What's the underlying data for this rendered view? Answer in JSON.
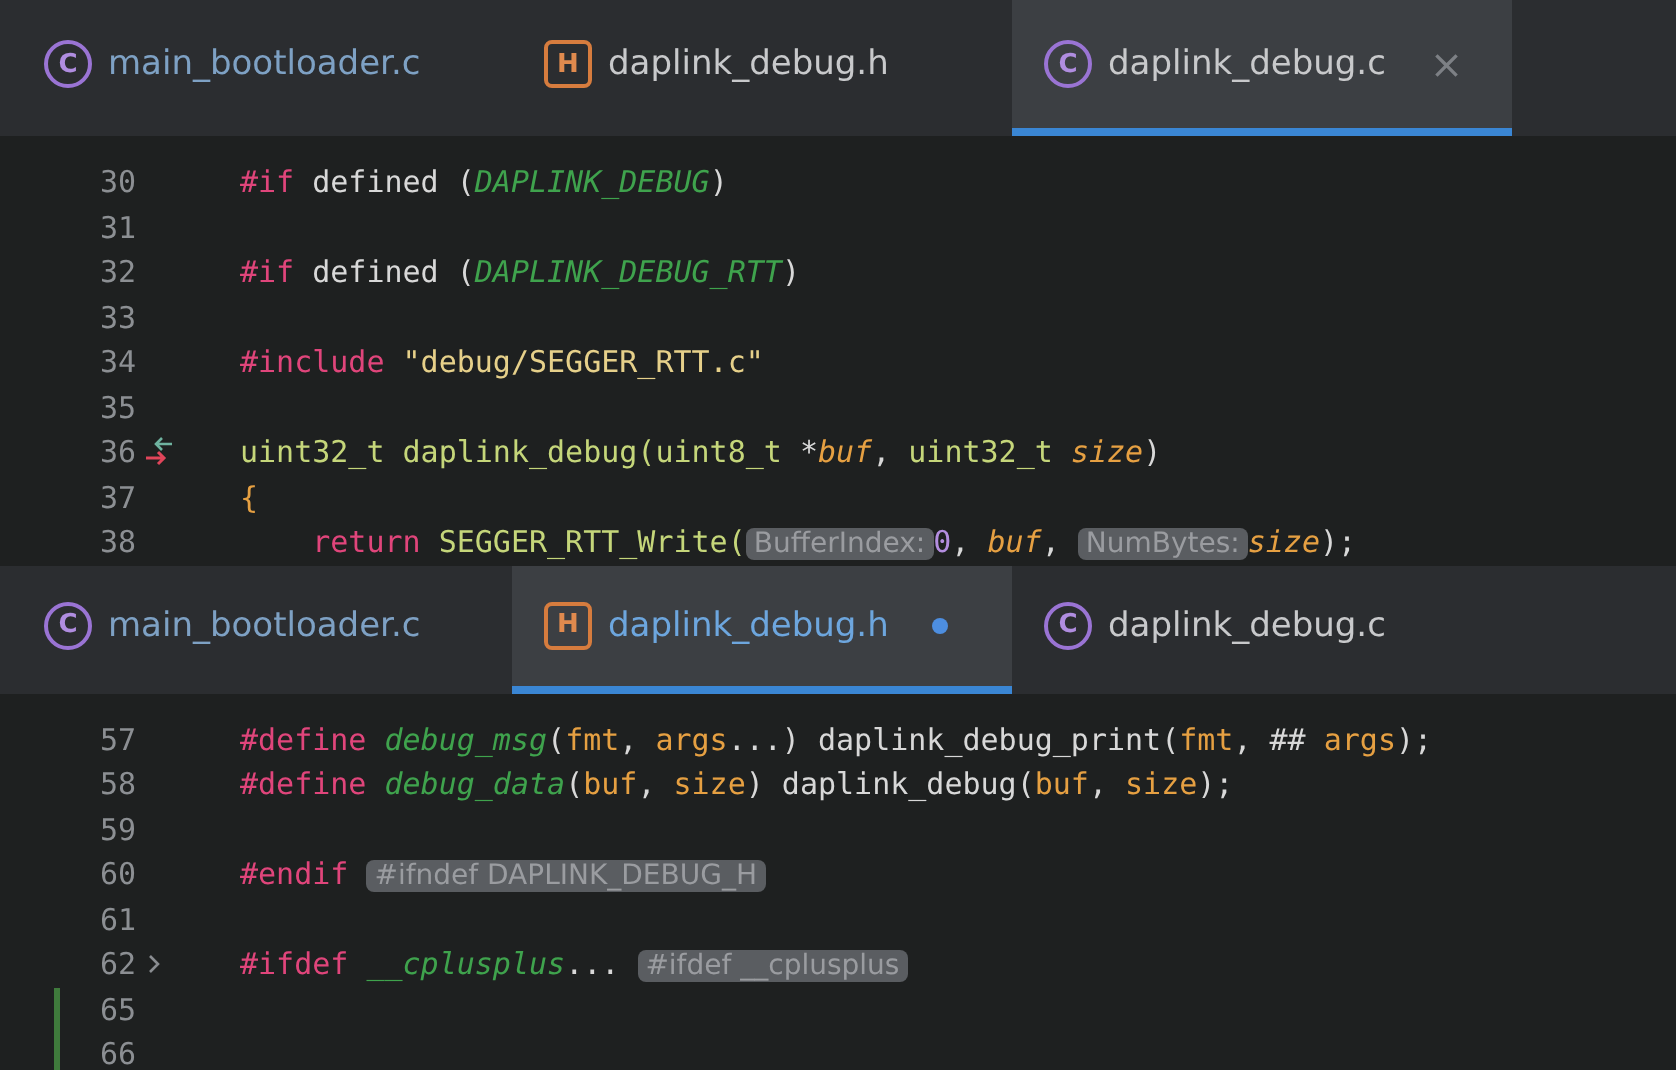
{
  "panes": [
    {
      "tabs": [
        {
          "icon": "C",
          "kind": "c",
          "label": "main_bootloader.c",
          "selected": false,
          "modified": false
        },
        {
          "icon": "H",
          "kind": "h",
          "label": "daplink_debug.h",
          "selected": false,
          "modified": false
        },
        {
          "icon": "C",
          "kind": "c",
          "label": "daplink_debug.c",
          "selected": true,
          "modified": false,
          "close": "×"
        }
      ],
      "lines": [
        {
          "number": "30",
          "kind": "code",
          "tokens": [
            {
              "kind": "keyword",
              "text": "#if"
            },
            {
              "kind": "plain",
              "text": " defined ("
            },
            {
              "kind": "macro",
              "text": "DAPLINK_DEBUG"
            },
            {
              "kind": "plain",
              "text": ")"
            }
          ]
        },
        {
          "number": "31",
          "kind": "code"
        },
        {
          "number": "32",
          "kind": "code",
          "tokens": [
            {
              "kind": "keyword",
              "text": "#if"
            },
            {
              "kind": "plain",
              "text": " defined ("
            },
            {
              "kind": "macro",
              "text": "DAPLINK_DEBUG_RTT"
            },
            {
              "kind": "plain",
              "text": ")"
            }
          ]
        },
        {
          "number": "33",
          "kind": "code"
        },
        {
          "number": "34",
          "kind": "code",
          "tokens": [
            {
              "kind": "keyword",
              "text": "#include "
            },
            {
              "kind": "string",
              "text": "\"debug/SEGGER_RTT.c\""
            }
          ]
        },
        {
          "number": "35",
          "kind": "code"
        },
        {
          "number": "36",
          "kind": "navigation",
          "tokens": [
            {
              "kind": "func",
              "text": "uint32_t daplink_debug(uint8_t "
            },
            {
              "kind": "plain",
              "text": "*"
            },
            {
              "kind": "param",
              "text": "buf"
            },
            {
              "kind": "plain",
              "text": ", "
            },
            {
              "kind": "func",
              "text": "uint32_t "
            },
            {
              "kind": "param",
              "text": "size"
            },
            {
              "kind": "plain",
              "text": ")"
            }
          ]
        },
        {
          "number": "37",
          "kind": "code",
          "tokens": [
            {
              "kind": "brace",
              "text": "{"
            }
          ]
        },
        {
          "number": "38",
          "kind": "code",
          "tokens": [
            {
              "kind": "keyword",
              "text": "    return"
            },
            {
              "kind": "func",
              "text": " SEGGER_RTT_Write("
            },
            {
              "kind": "hint",
              "text": "BufferIndex:"
            },
            {
              "kind": "number",
              "text": "0"
            },
            {
              "kind": "plain",
              "text": ", "
            },
            {
              "kind": "param",
              "text": "buf"
            },
            {
              "kind": "plain",
              "text": ", "
            },
            {
              "kind": "hint",
              "text": "NumBytes:"
            },
            {
              "kind": "param",
              "text": "size"
            },
            {
              "kind": "plain",
              "text": ");"
            }
          ]
        }
      ]
    },
    {
      "tabs": [
        {
          "icon": "C",
          "kind": "c",
          "label": "main_bootloader.c",
          "selected": false,
          "modified": false
        },
        {
          "icon": "H",
          "kind": "h",
          "label": "daplink_debug.h",
          "selected": true,
          "modified": true
        },
        {
          "icon": "C",
          "kind": "c",
          "label": "daplink_debug.c",
          "selected": false,
          "modified": false
        }
      ],
      "lines": [
        {
          "number": "57",
          "kind": "code",
          "tokens": [
            {
              "kind": "keyword",
              "text": "#define "
            },
            {
              "kind": "macro",
              "text": "debug_msg"
            },
            {
              "kind": "plain",
              "text": "("
            },
            {
              "kind": "arg",
              "text": "fmt"
            },
            {
              "kind": "plain",
              "text": ", "
            },
            {
              "kind": "arg",
              "text": "args"
            },
            {
              "kind": "plain",
              "text": "...) daplink_debug_print("
            },
            {
              "kind": "arg",
              "text": "fmt"
            },
            {
              "kind": "plain",
              "text": ", ## "
            },
            {
              "kind": "arg",
              "text": "args"
            },
            {
              "kind": "plain",
              "text": ");"
            }
          ]
        },
        {
          "number": "58",
          "kind": "code",
          "tokens": [
            {
              "kind": "keyword",
              "text": "#define "
            },
            {
              "kind": "macro",
              "text": "debug_data"
            },
            {
              "kind": "plain",
              "text": "("
            },
            {
              "kind": "arg",
              "text": "buf"
            },
            {
              "kind": "plain",
              "text": ", "
            },
            {
              "kind": "arg",
              "text": "size"
            },
            {
              "kind": "plain",
              "text": ") daplink_debug("
            },
            {
              "kind": "arg",
              "text": "buf"
            },
            {
              "kind": "plain",
              "text": ", "
            },
            {
              "kind": "arg",
              "text": "size"
            },
            {
              "kind": "plain",
              "text": ");"
            }
          ]
        },
        {
          "number": "59",
          "kind": "code"
        },
        {
          "number": "60",
          "kind": "code",
          "tokens": [
            {
              "kind": "keyword",
              "text": "#endif "
            },
            {
              "kind": "hint",
              "text": "#ifndef DAPLINK_DEBUG_H"
            }
          ]
        },
        {
          "number": "61",
          "kind": "code"
        },
        {
          "number": "62",
          "kind": "fold",
          "tokens": [
            {
              "kind": "keyword",
              "text": "#ifdef "
            },
            {
              "kind": "macro",
              "text": "__cplusplus"
            },
            {
              "kind": "plain",
              "text": "... "
            },
            {
              "kind": "hint",
              "text": "#ifdef __cplusplus"
            }
          ]
        },
        {
          "number": "65",
          "kind": "code",
          "changed": true
        },
        {
          "number": "66",
          "kind": "code",
          "changed": true
        }
      ]
    }
  ]
}
